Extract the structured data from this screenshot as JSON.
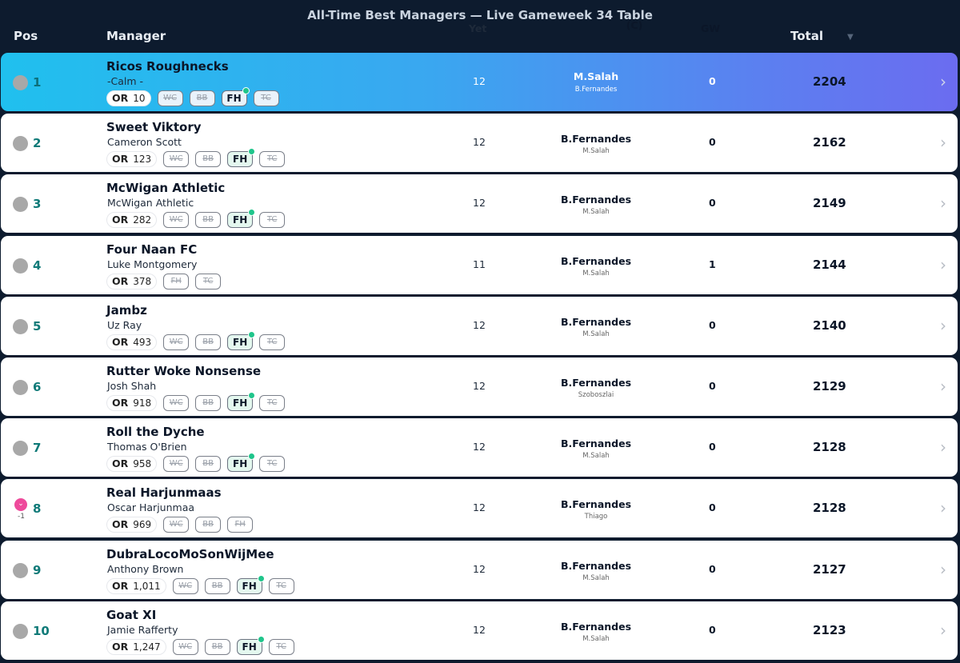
{
  "title": "All-Time Best Managers — Live Gameweek 34 Table",
  "headers": {
    "pos": "Pos",
    "manager": "Manager",
    "yet": "Yet",
    "captain": "(C)",
    "gw": "GW",
    "total": "Total",
    "sort_icon": "▼"
  },
  "rows": [
    {
      "rank": "1",
      "change": "",
      "team": "Ricos Roughnecks",
      "manager": "-Calm -",
      "or_label": "OR",
      "or_value": "10",
      "chips": [
        {
          "label": "WC",
          "used": true
        },
        {
          "label": "BB",
          "used": true
        },
        {
          "label": "FH",
          "used": false
        },
        {
          "label": "TC",
          "used": true
        }
      ],
      "yet": "12",
      "captain": "M.Salah",
      "vice": "B.Fernandes",
      "gw": "0",
      "total": "2204"
    },
    {
      "rank": "2",
      "change": "",
      "team": "Sweet Viktory",
      "manager": "Cameron Scott",
      "or_label": "OR",
      "or_value": "123",
      "chips": [
        {
          "label": "WC",
          "used": true
        },
        {
          "label": "BB",
          "used": true
        },
        {
          "label": "FH",
          "used": false
        },
        {
          "label": "TC",
          "used": true
        }
      ],
      "yet": "12",
      "captain": "B.Fernandes",
      "vice": "M.Salah",
      "gw": "0",
      "total": "2162"
    },
    {
      "rank": "3",
      "change": "",
      "team": "McWigan Athletic",
      "manager": "McWigan Athletic",
      "or_label": "OR",
      "or_value": "282",
      "chips": [
        {
          "label": "WC",
          "used": true
        },
        {
          "label": "BB",
          "used": true
        },
        {
          "label": "FH",
          "used": false
        },
        {
          "label": "TC",
          "used": true
        }
      ],
      "yet": "12",
      "captain": "B.Fernandes",
      "vice": "M.Salah",
      "gw": "0",
      "total": "2149"
    },
    {
      "rank": "4",
      "change": "",
      "team": "Four Naan FC",
      "manager": "Luke Montgomery",
      "or_label": "OR",
      "or_value": "378",
      "chips": [
        {
          "label": "FH",
          "used": true
        },
        {
          "label": "TC",
          "used": true
        }
      ],
      "yet": "11",
      "captain": "B.Fernandes",
      "vice": "M.Salah",
      "gw": "1",
      "total": "2144"
    },
    {
      "rank": "5",
      "change": "",
      "team": "Jambz",
      "manager": "Uz Ray",
      "or_label": "OR",
      "or_value": "493",
      "chips": [
        {
          "label": "WC",
          "used": true
        },
        {
          "label": "BB",
          "used": true
        },
        {
          "label": "FH",
          "used": false
        },
        {
          "label": "TC",
          "used": true
        }
      ],
      "yet": "12",
      "captain": "B.Fernandes",
      "vice": "M.Salah",
      "gw": "0",
      "total": "2140"
    },
    {
      "rank": "6",
      "change": "",
      "team": "Rutter Woke Nonsense",
      "manager": "Josh Shah",
      "or_label": "OR",
      "or_value": "918",
      "chips": [
        {
          "label": "WC",
          "used": true
        },
        {
          "label": "BB",
          "used": true
        },
        {
          "label": "FH",
          "used": false
        },
        {
          "label": "TC",
          "used": true
        }
      ],
      "yet": "12",
      "captain": "B.Fernandes",
      "vice": "Szoboszlai",
      "gw": "0",
      "total": "2129"
    },
    {
      "rank": "7",
      "change": "",
      "team": "Roll the Dyche",
      "manager": "Thomas O'Brien",
      "or_label": "OR",
      "or_value": "958",
      "chips": [
        {
          "label": "WC",
          "used": true
        },
        {
          "label": "BB",
          "used": true
        },
        {
          "label": "FH",
          "used": false
        },
        {
          "label": "TC",
          "used": true
        }
      ],
      "yet": "12",
      "captain": "B.Fernandes",
      "vice": "M.Salah",
      "gw": "0",
      "total": "2128"
    },
    {
      "rank": "8",
      "change": "-1",
      "team": "Real Harjunmaas",
      "manager": "Oscar Harjunmaa",
      "or_label": "OR",
      "or_value": "969",
      "chips": [
        {
          "label": "WC",
          "used": true
        },
        {
          "label": "BB",
          "used": true
        },
        {
          "label": "FH",
          "used": true
        }
      ],
      "yet": "12",
      "captain": "B.Fernandes",
      "vice": "Thiago",
      "gw": "0",
      "total": "2128"
    },
    {
      "rank": "9",
      "change": "",
      "team": "DubraLocoMoSonWijMee",
      "manager": "Anthony Brown",
      "or_label": "OR",
      "or_value": "1,011",
      "chips": [
        {
          "label": "WC",
          "used": true
        },
        {
          "label": "BB",
          "used": true
        },
        {
          "label": "FH",
          "used": false
        },
        {
          "label": "TC",
          "used": true
        }
      ],
      "yet": "12",
      "captain": "B.Fernandes",
      "vice": "M.Salah",
      "gw": "0",
      "total": "2127"
    },
    {
      "rank": "10",
      "change": "",
      "team": "Goat XI",
      "manager": "Jamie Rafferty",
      "or_label": "OR",
      "or_value": "1,247",
      "chips": [
        {
          "label": "WC",
          "used": true
        },
        {
          "label": "BB",
          "used": true
        },
        {
          "label": "FH",
          "used": false
        },
        {
          "label": "TC",
          "used": true
        }
      ],
      "yet": "12",
      "captain": "B.Fernandes",
      "vice": "M.Salah",
      "gw": "0",
      "total": "2123"
    }
  ],
  "colors": {
    "background": "#0d1b2e",
    "rank_number": "#0f7a78",
    "active_chip_dot": "#1fc58b",
    "rank_down": "#ee4a9b"
  },
  "icons": {
    "row_arrow": "chevron-right-icon",
    "rank_neutral": "rank-neutral-dot-icon",
    "rank_down": "rank-down-icon",
    "active_chip": "active-chip-dot-icon"
  }
}
